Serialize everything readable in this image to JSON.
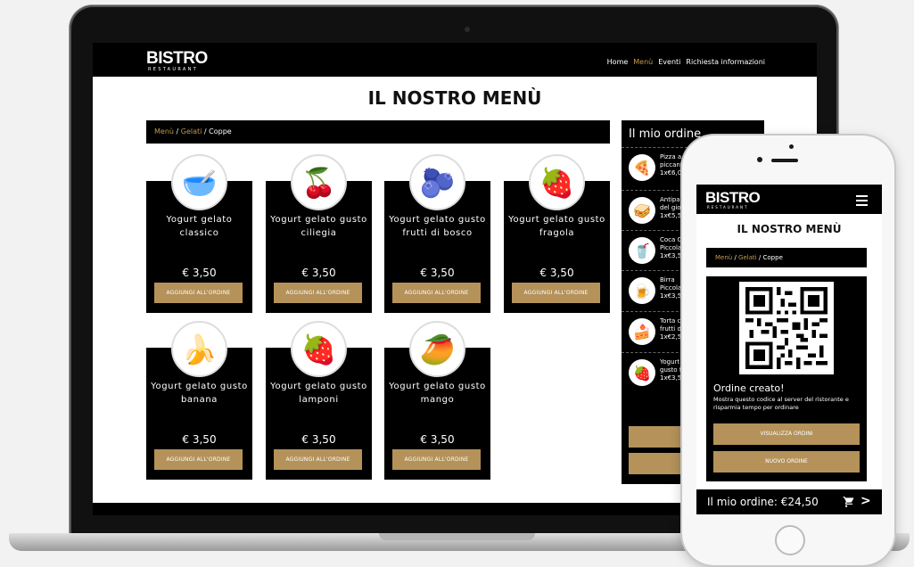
{
  "desktop": {
    "logo": {
      "word": "BISTRO",
      "sub": "RESTAURANT"
    },
    "nav": [
      {
        "label": "Home",
        "active": false
      },
      {
        "label": "Menù",
        "active": true
      },
      {
        "label": "Eventi",
        "active": false
      },
      {
        "label": "Richiesta informazioni",
        "active": false
      }
    ],
    "page_title": "IL NOSTRO MENÙ",
    "breadcrumb": {
      "level1": "Menù",
      "sep": " / ",
      "level2": "Gelati",
      "level3": "Coppe"
    },
    "products": [
      {
        "name": "Yogurt gelato classico",
        "price": "€ 3,50",
        "button": "AGGIUNGI ALL'ORDINE",
        "icon": "yogurt-icon",
        "glyph": "🥣"
      },
      {
        "name": "Yogurt gelato gusto ciliegia",
        "price": "€ 3,50",
        "button": "AGGIUNGI ALL'ORDINE",
        "icon": "cherry-icon",
        "glyph": "🍒"
      },
      {
        "name": "Yogurt gelato gusto frutti di bosco",
        "price": "€ 3,50",
        "button": "AGGIUNGI ALL'ORDINE",
        "icon": "berries-icon",
        "glyph": "🫐"
      },
      {
        "name": "Yogurt gelato gusto fragola",
        "price": "€ 3,50",
        "button": "AGGIUNGI ALL'ORDINE",
        "icon": "strawberry-icon",
        "glyph": "🍓"
      },
      {
        "name": "Yogurt gelato gusto banana",
        "price": "€ 3,50",
        "button": "AGGIUNGI ALL'ORDINE",
        "icon": "banana-icon",
        "glyph": "🍌"
      },
      {
        "name": "Yogurt gelato gusto lamponi",
        "price": "€ 3,50",
        "button": "AGGIUNGI ALL'ORDINE",
        "icon": "raspberry-icon",
        "glyph": "🍓"
      },
      {
        "name": "Yogurt gelato gusto mango",
        "price": "€ 3,50",
        "button": "AGGIUNGI ALL'ORDINE",
        "icon": "mango-icon",
        "glyph": "🥭"
      }
    ],
    "order": {
      "title": "Il mio ordine",
      "items": [
        {
          "line1": "Pizza a",
          "line2": "piccant",
          "line3": "1x€6,00",
          "icon": "pizza-icon",
          "glyph": "🍕"
        },
        {
          "line1": "Antipa",
          "line2": "del gio",
          "line3": "1x€5,5",
          "icon": "appetizer-icon",
          "glyph": "🥪"
        },
        {
          "line1": "Coca C",
          "line2": "Piccola",
          "line3": "1x€3,5",
          "icon": "cola-icon",
          "glyph": "🥤"
        },
        {
          "line1": "Birra",
          "line2": "Piccola",
          "line3": "1x€3,5",
          "icon": "beer-icon",
          "glyph": "🍺"
        },
        {
          "line1": "Torta c",
          "line2": "frutti d",
          "line3": "1x€2,5",
          "icon": "cake-icon",
          "glyph": "🍰"
        },
        {
          "line1": "Yogurt",
          "line2": "gusto f",
          "line3": "1x€3,5",
          "icon": "yogurt-strawberry-icon",
          "glyph": "🍓"
        }
      ],
      "btn1": "VISUA",
      "btn2": "NUO"
    }
  },
  "mobile": {
    "logo": {
      "word": "BISTRO",
      "sub": "RESTAURANT"
    },
    "page_title": "IL NOSTRO MENÙ",
    "breadcrumb": {
      "level1": "Menù",
      "sep": " / ",
      "level2": "Gelati",
      "level3": "Coppe"
    },
    "order_created": "Ordine creato!",
    "description": "Mostra questo codice al server del ristorante e risparmia tempo per ordinare",
    "btn_view": "VISUALIZZA ORDINI",
    "btn_new": "NUOVO ORDINE",
    "footer_total": "Il mio ordine: €24,50"
  },
  "colors": {
    "accent": "#b4925a",
    "nav_active": "#c49a4b",
    "dark": "#000000"
  }
}
